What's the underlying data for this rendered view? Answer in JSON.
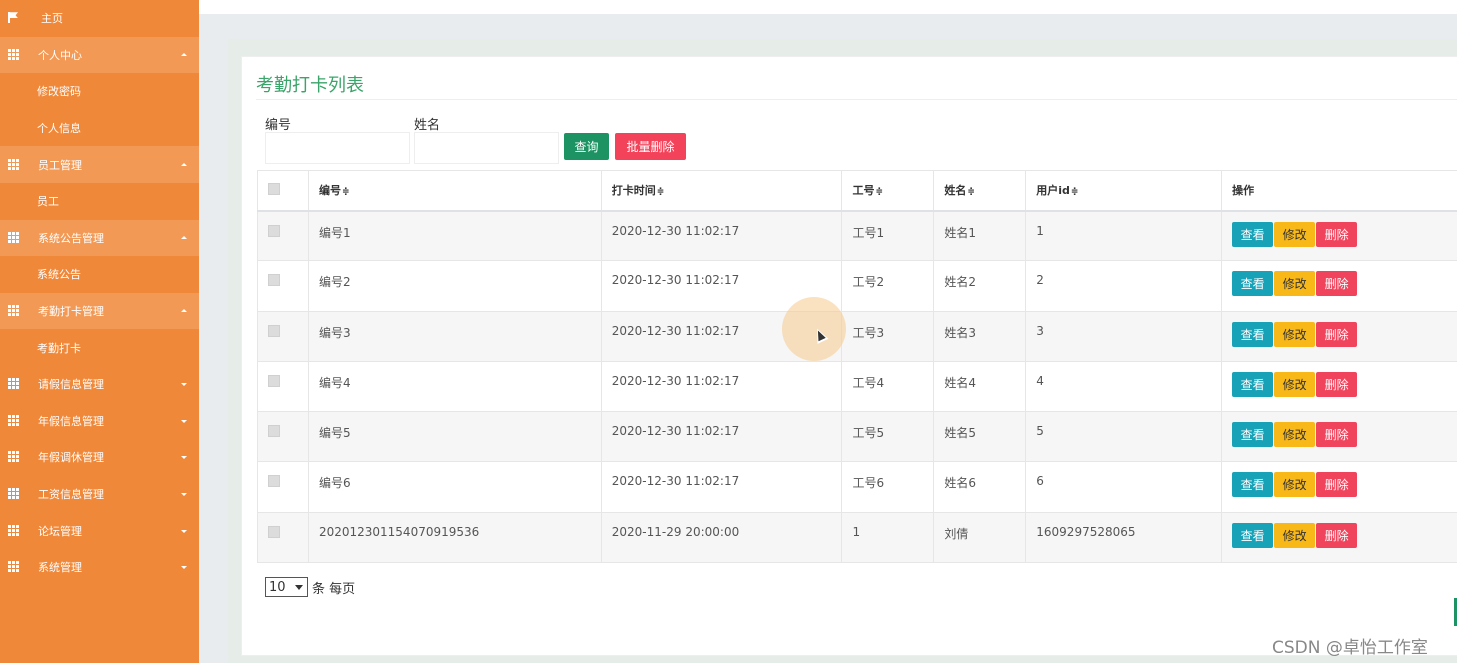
{
  "sidebar": {
    "items": [
      {
        "label": "主页",
        "type": "parent",
        "icon": "flag-icon",
        "state": "none"
      },
      {
        "label": "个人中心",
        "type": "parent",
        "icon": "grid-icon",
        "state": "open"
      },
      {
        "label": "修改密码",
        "type": "child"
      },
      {
        "label": "个人信息",
        "type": "child"
      },
      {
        "label": "员工管理",
        "type": "parent",
        "icon": "grid-icon",
        "state": "open"
      },
      {
        "label": "员工",
        "type": "child"
      },
      {
        "label": "系统公告管理",
        "type": "parent",
        "icon": "grid-icon",
        "state": "open"
      },
      {
        "label": "系统公告",
        "type": "child"
      },
      {
        "label": "考勤打卡管理",
        "type": "parent",
        "icon": "grid-icon",
        "state": "open"
      },
      {
        "label": "考勤打卡",
        "type": "child"
      },
      {
        "label": "请假信息管理",
        "type": "parent",
        "icon": "grid-icon",
        "state": "closed"
      },
      {
        "label": "年假信息管理",
        "type": "parent",
        "icon": "grid-icon",
        "state": "closed"
      },
      {
        "label": "年假调休管理",
        "type": "parent",
        "icon": "grid-icon",
        "state": "closed"
      },
      {
        "label": "工资信息管理",
        "type": "parent",
        "icon": "grid-icon",
        "state": "closed"
      },
      {
        "label": "论坛管理",
        "type": "parent",
        "icon": "grid-icon",
        "state": "closed"
      },
      {
        "label": "系统管理",
        "type": "parent",
        "icon": "grid-icon",
        "state": "closed"
      }
    ]
  },
  "page": {
    "title": "考勤打卡列表"
  },
  "search": {
    "field1_label": "编号",
    "field1_value": "",
    "field2_label": "姓名",
    "field2_value": "",
    "query_label": "查询",
    "batch_delete_label": "批量删除"
  },
  "table": {
    "headers": [
      "编号",
      "打卡时间",
      "工号",
      "姓名",
      "用户id",
      "操作"
    ],
    "sort_glyph": "≑",
    "rows": [
      [
        "编号1",
        "2020-12-30 11:02:17",
        "工号1",
        "姓名1",
        "1"
      ],
      [
        "编号2",
        "2020-12-30 11:02:17",
        "工号2",
        "姓名2",
        "2"
      ],
      [
        "编号3",
        "2020-12-30 11:02:17",
        "工号3",
        "姓名3",
        "3"
      ],
      [
        "编号4",
        "2020-12-30 11:02:17",
        "工号4",
        "姓名4",
        "4"
      ],
      [
        "编号5",
        "2020-12-30 11:02:17",
        "工号5",
        "姓名5",
        "5"
      ],
      [
        "编号6",
        "2020-12-30 11:02:17",
        "工号6",
        "姓名6",
        "6"
      ],
      [
        "202012301154070919536",
        "2020-11-29 20:00:00",
        "1",
        "刘倩",
        "1609297528065"
      ]
    ],
    "actions": {
      "view": "查看",
      "edit": "修改",
      "delete": "删除"
    }
  },
  "pager": {
    "page_size": "10",
    "suffix": "条 每页"
  },
  "watermark": "CSDN @卓怡工作室",
  "colors": {
    "sidebar": "#f0883a",
    "title": "#3ba46a",
    "query_button": "#1d9364",
    "danger": "#f2435a",
    "view": "#17a2b8",
    "edit": "#f8b818"
  }
}
